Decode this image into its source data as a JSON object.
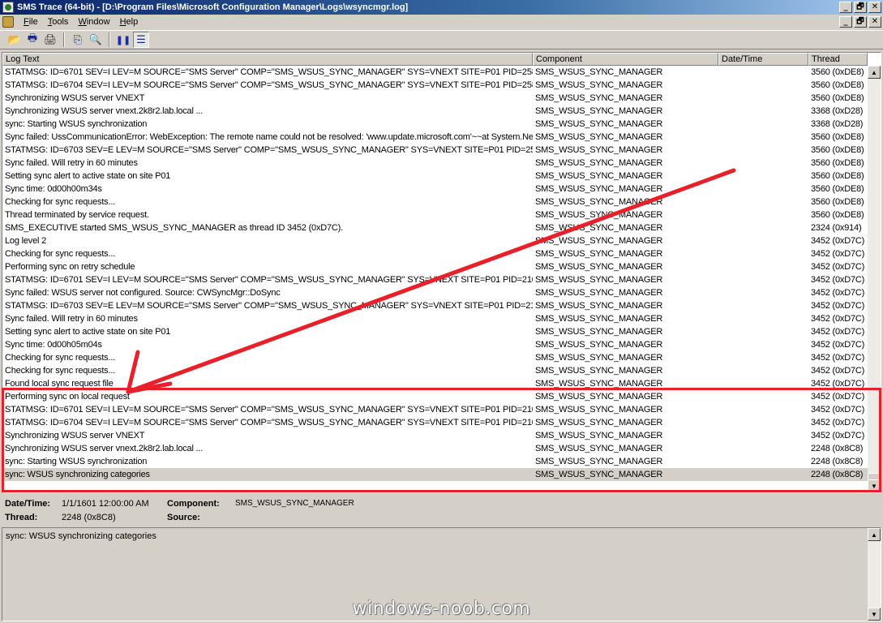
{
  "window": {
    "title": "SMS Trace (64-bit) - [D:\\Program Files\\Microsoft Configuration Manager\\Logs\\wsyncmgr.log]",
    "minimize": "_",
    "restore": "🗗",
    "close": "✕"
  },
  "menu": {
    "items": [
      {
        "label": "File",
        "underline": "F",
        "rest": "ile"
      },
      {
        "label": "Tools",
        "underline": "T",
        "rest": "ools"
      },
      {
        "label": "Window",
        "underline": "W",
        "rest": "indow"
      },
      {
        "label": "Help",
        "underline": "H",
        "rest": "elp"
      }
    ]
  },
  "toolbar": {
    "open_icon": "📂",
    "print_preview_icon": "🖶",
    "print_icon": "🖨",
    "copy_icon": "⎘",
    "find_icon": "🔍",
    "pause_icon": "❚❚",
    "view_icon": "☰"
  },
  "columns": {
    "log_text": "Log Text",
    "component": "Component",
    "date_time": "Date/Time",
    "thread": "Thread"
  },
  "rows": [
    {
      "text": "STATMSG: ID=6701 SEV=I LEV=M SOURCE=\"SMS Server\" COMP=\"SMS_WSUS_SYNC_MANAGER\" SYS=VNEXT SITE=P01 PID=2580 TID",
      "comp": "SMS_WSUS_SYNC_MANAGER",
      "date": "",
      "thread": "3560 (0xDE8)"
    },
    {
      "text": "STATMSG: ID=6704 SEV=I LEV=M SOURCE=\"SMS Server\" COMP=\"SMS_WSUS_SYNC_MANAGER\" SYS=VNEXT SITE=P01 PID=2580 TID",
      "comp": "SMS_WSUS_SYNC_MANAGER",
      "date": "",
      "thread": "3560 (0xDE8)"
    },
    {
      "text": "Synchronizing WSUS server VNEXT",
      "comp": "SMS_WSUS_SYNC_MANAGER",
      "date": "",
      "thread": "3560 (0xDE8)"
    },
    {
      "text": "Synchronizing WSUS server vnext.2k8r2.lab.local ...",
      "comp": "SMS_WSUS_SYNC_MANAGER",
      "date": "",
      "thread": "3368 (0xD28)"
    },
    {
      "text": "sync: Starting WSUS synchronization",
      "comp": "SMS_WSUS_SYNC_MANAGER",
      "date": "",
      "thread": "3368 (0xD28)"
    },
    {
      "text": "Sync failed: UssCommunicationError: WebException: The remote name could not be resolved: 'www.update.microsoft.com'~~at System.Net.HttpW",
      "comp": "SMS_WSUS_SYNC_MANAGER",
      "date": "",
      "thread": "3560 (0xDE8)"
    },
    {
      "text": "STATMSG: ID=6703 SEV=E LEV=M SOURCE=\"SMS Server\" COMP=\"SMS_WSUS_SYNC_MANAGER\" SYS=VNEXT SITE=P01 PID=2580 TII",
      "comp": "SMS_WSUS_SYNC_MANAGER",
      "date": "",
      "thread": "3560 (0xDE8)"
    },
    {
      "text": "Sync failed. Will retry in 60 minutes",
      "comp": "SMS_WSUS_SYNC_MANAGER",
      "date": "",
      "thread": "3560 (0xDE8)"
    },
    {
      "text": "Setting sync alert to active state on site P01",
      "comp": "SMS_WSUS_SYNC_MANAGER",
      "date": "",
      "thread": "3560 (0xDE8)"
    },
    {
      "text": "Sync time: 0d00h00m34s",
      "comp": "SMS_WSUS_SYNC_MANAGER",
      "date": "",
      "thread": "3560 (0xDE8)"
    },
    {
      "text": "Checking for sync requests...",
      "comp": "SMS_WSUS_SYNC_MANAGER",
      "date": "",
      "thread": "3560 (0xDE8)"
    },
    {
      "text": "Thread terminated by service request.",
      "comp": "SMS_WSUS_SYNC_MANAGER",
      "date": "",
      "thread": "3560 (0xDE8)"
    },
    {
      "text": "SMS_EXECUTIVE started SMS_WSUS_SYNC_MANAGER as thread ID 3452 (0xD7C).",
      "comp": "SMS_WSUS_SYNC_MANAGER",
      "date": "",
      "thread": "2324 (0x914)"
    },
    {
      "text": "Log level 2",
      "comp": "SMS_WSUS_SYNC_MANAGER",
      "date": "",
      "thread": "3452 (0xD7C)"
    },
    {
      "text": "Checking for sync requests...",
      "comp": "SMS_WSUS_SYNC_MANAGER",
      "date": "",
      "thread": "3452 (0xD7C)"
    },
    {
      "text": "Performing sync on retry schedule",
      "comp": "SMS_WSUS_SYNC_MANAGER",
      "date": "",
      "thread": "3452 (0xD7C)"
    },
    {
      "text": "STATMSG: ID=6701 SEV=I LEV=M SOURCE=\"SMS Server\" COMP=\"SMS_WSUS_SYNC_MANAGER\" SYS=VNEXT SITE=P01 PID=2108 TID",
      "comp": "SMS_WSUS_SYNC_MANAGER",
      "date": "",
      "thread": "3452 (0xD7C)"
    },
    {
      "text": "Sync failed: WSUS server not configured. Source: CWSyncMgr::DoSync",
      "comp": "SMS_WSUS_SYNC_MANAGER",
      "date": "",
      "thread": "3452 (0xD7C)"
    },
    {
      "text": "STATMSG: ID=6703 SEV=E LEV=M SOURCE=\"SMS Server\" COMP=\"SMS_WSUS_SYNC_MANAGER\" SYS=VNEXT SITE=P01 PID=2108 TII",
      "comp": "SMS_WSUS_SYNC_MANAGER",
      "date": "",
      "thread": "3452 (0xD7C)"
    },
    {
      "text": "Sync failed. Will retry in 60 minutes",
      "comp": "SMS_WSUS_SYNC_MANAGER",
      "date": "",
      "thread": "3452 (0xD7C)"
    },
    {
      "text": "Setting sync alert to active state on site P01",
      "comp": "SMS_WSUS_SYNC_MANAGER",
      "date": "",
      "thread": "3452 (0xD7C)"
    },
    {
      "text": "Sync time: 0d00h05m04s",
      "comp": "SMS_WSUS_SYNC_MANAGER",
      "date": "",
      "thread": "3452 (0xD7C)"
    },
    {
      "text": "Checking for sync requests...",
      "comp": "SMS_WSUS_SYNC_MANAGER",
      "date": "",
      "thread": "3452 (0xD7C)"
    },
    {
      "text": "Checking for sync requests...",
      "comp": "SMS_WSUS_SYNC_MANAGER",
      "date": "",
      "thread": "3452 (0xD7C)"
    },
    {
      "text": "Found local sync request file",
      "comp": "SMS_WSUS_SYNC_MANAGER",
      "date": "",
      "thread": "3452 (0xD7C)"
    },
    {
      "text": "Performing sync on local request",
      "comp": "SMS_WSUS_SYNC_MANAGER",
      "date": "",
      "thread": "3452 (0xD7C)"
    },
    {
      "text": "STATMSG: ID=6701 SEV=I LEV=M SOURCE=\"SMS Server\" COMP=\"SMS_WSUS_SYNC_MANAGER\" SYS=VNEXT SITE=P01 PID=2108 TID",
      "comp": "SMS_WSUS_SYNC_MANAGER",
      "date": "",
      "thread": "3452 (0xD7C)"
    },
    {
      "text": "STATMSG: ID=6704 SEV=I LEV=M SOURCE=\"SMS Server\" COMP=\"SMS_WSUS_SYNC_MANAGER\" SYS=VNEXT SITE=P01 PID=2108 TID",
      "comp": "SMS_WSUS_SYNC_MANAGER",
      "date": "",
      "thread": "3452 (0xD7C)"
    },
    {
      "text": "Synchronizing WSUS server VNEXT",
      "comp": "SMS_WSUS_SYNC_MANAGER",
      "date": "",
      "thread": "3452 (0xD7C)"
    },
    {
      "text": "Synchronizing WSUS server vnext.2k8r2.lab.local ...",
      "comp": "SMS_WSUS_SYNC_MANAGER",
      "date": "",
      "thread": "2248 (0x8C8)"
    },
    {
      "text": "sync: Starting WSUS synchronization",
      "comp": "SMS_WSUS_SYNC_MANAGER",
      "date": "",
      "thread": "2248 (0x8C8)"
    },
    {
      "text": "sync: WSUS synchronizing categories",
      "comp": "SMS_WSUS_SYNC_MANAGER",
      "date": "",
      "thread": "2248 (0x8C8)",
      "selected": true
    }
  ],
  "scroll": {
    "up": "▲",
    "down": "▼"
  },
  "details": {
    "datetime_label": "Date/Time:",
    "datetime_value": "1/1/1601 12:00:00 AM",
    "component_label": "Component:",
    "component_value": "SMS_WSUS_SYNC_MANAGER",
    "thread_label": "Thread:",
    "thread_value": "2248 (0x8C8)",
    "source_label": "Source:",
    "source_value": ""
  },
  "message": {
    "text": "sync: WSUS synchronizing categories"
  },
  "watermark": "windows-noob.com",
  "colors": {
    "annotation": "#e8202a",
    "titlebar": "#0a246a"
  }
}
